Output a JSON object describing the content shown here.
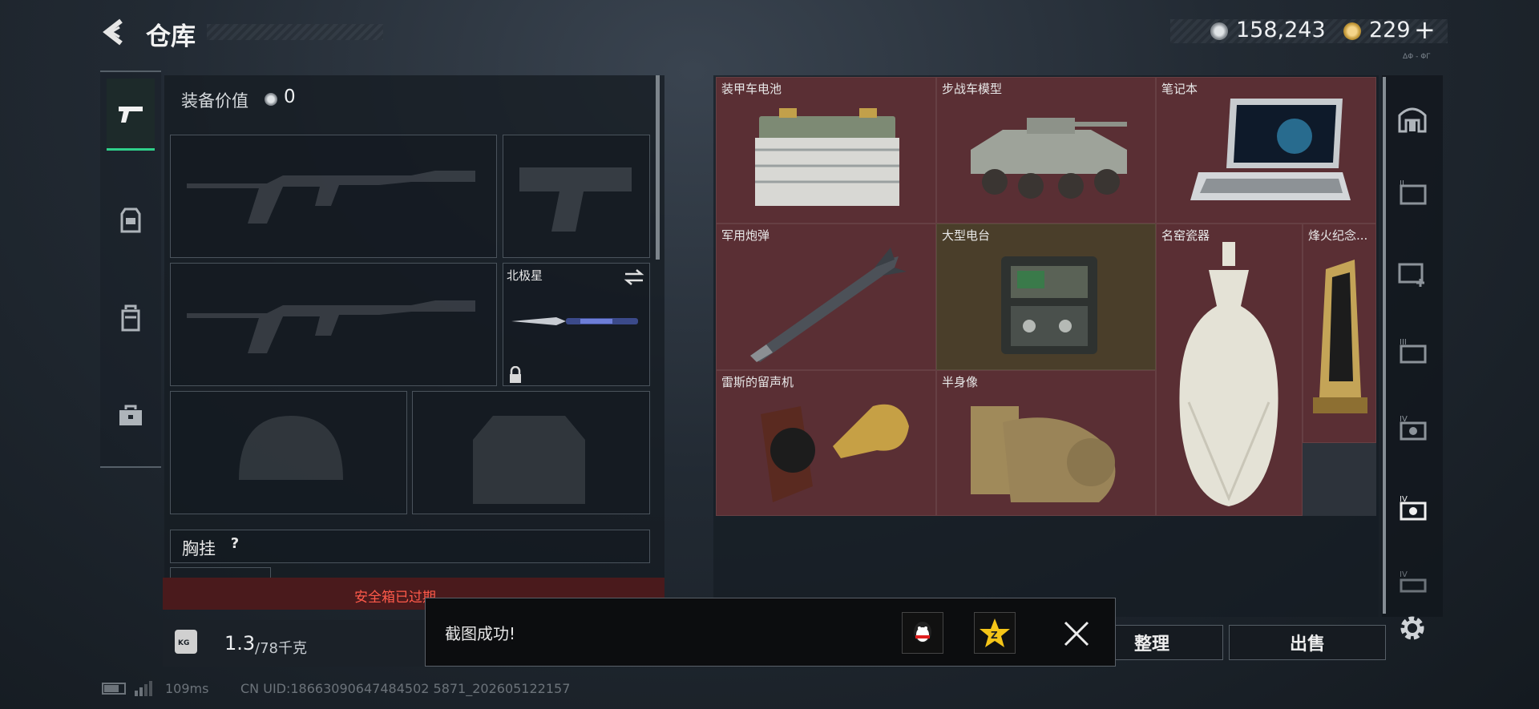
{
  "header": {
    "title": "仓库",
    "silver": "158,243",
    "gold": "229",
    "plus": "+",
    "fps": "ΔΦ - ΦΓ"
  },
  "left_tabs": [
    {
      "name": "weapon-icon"
    },
    {
      "name": "armor-icon"
    },
    {
      "name": "backpack-icon"
    },
    {
      "name": "toolbox-icon"
    }
  ],
  "equipment": {
    "value_label": "装备价值",
    "value": "0",
    "knife_label": "北极星",
    "chest_rig_label": "胸挂",
    "help": "?"
  },
  "safebox": {
    "warning": "安全箱已过期"
  },
  "weight": {
    "current": "1.3",
    "max": "/78千克",
    "kg_badge": "KG"
  },
  "items": [
    {
      "label": "装甲车电池"
    },
    {
      "label": "步战车模型"
    },
    {
      "label": "笔记本"
    },
    {
      "label": "军用炮弹"
    },
    {
      "label": "大型电台"
    },
    {
      "label": "名窑瓷器"
    },
    {
      "label": "烽火纪念..."
    },
    {
      "label": "雷斯的留声机"
    },
    {
      "label": "半身像"
    }
  ],
  "right_tabs": [
    {
      "name": "vault-icon",
      "tag": ""
    },
    {
      "name": "storage-2-icon",
      "tag": "II"
    },
    {
      "name": "storage-add-icon",
      "tag": ""
    },
    {
      "name": "storage-3-icon",
      "tag": "III"
    },
    {
      "name": "storage-4-icon",
      "tag": "IV"
    },
    {
      "name": "storage-4-selected-icon",
      "tag": "IV"
    },
    {
      "name": "storage-4b-icon",
      "tag": "IV"
    }
  ],
  "buttons": {
    "sort": "整理",
    "sell": "出售"
  },
  "toast": {
    "message": "截图成功!"
  },
  "status": {
    "ping": "109ms",
    "uid": "CN UID:18663090647484502 5871_202605122157"
  },
  "colors": {
    "item_bg": "#5a2f34",
    "accent_green": "#2fd08a",
    "warning_red": "#e03a3a"
  }
}
